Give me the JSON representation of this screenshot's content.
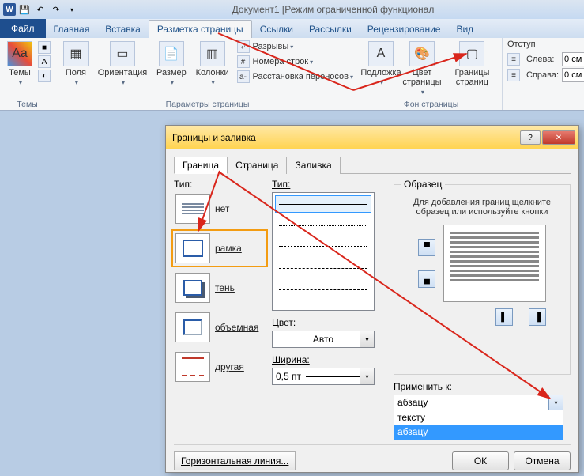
{
  "titlebar": {
    "doc_title": "Документ1 [Режим ограниченной функционал"
  },
  "tabs": {
    "file": "Файл",
    "items": [
      "Главная",
      "Вставка",
      "Разметка страницы",
      "Ссылки",
      "Рассылки",
      "Рецензирование",
      "Вид"
    ],
    "active_index": 2
  },
  "ribbon": {
    "themes": {
      "label": "Темы",
      "group": "Темы"
    },
    "page_params": {
      "fields": "Поля",
      "orientation": "Ориентация",
      "size": "Размер",
      "columns": "Колонки",
      "breaks": "Разрывы",
      "line_numbers": "Номера строк",
      "hyphenation": "Расстановка переносов",
      "group": "Параметры страницы"
    },
    "page_bg": {
      "watermark": "Подложка",
      "color": "Цвет страницы",
      "borders": "Границы страниц",
      "group": "Фон страницы"
    },
    "indent": {
      "header": "Отступ",
      "left": "Слева:",
      "right": "Справа:",
      "left_val": "0 см",
      "right_val": "0 см"
    }
  },
  "dialog": {
    "title": "Границы и заливка",
    "tabs": [
      "Граница",
      "Страница",
      "Заливка"
    ],
    "active_tab": 0,
    "type_label": "Тип:",
    "types": [
      {
        "name": "нет"
      },
      {
        "name": "рамка"
      },
      {
        "name": "тень"
      },
      {
        "name": "объемная"
      },
      {
        "name": "другая"
      }
    ],
    "selected_type": 1,
    "style_label": "Тип:",
    "color_label": "Цвет:",
    "color_value": "Авто",
    "width_label": "Ширина:",
    "width_value": "0,5 пт",
    "preview_label": "Образец",
    "preview_hint": "Для добавления границ щелкните образец или используйте кнопки",
    "apply_label": "Применить к:",
    "apply_selected": "абзацу",
    "apply_options": [
      "тексту",
      "абзацу"
    ],
    "hline": "Горизонтальная линия...",
    "ok": "ОК",
    "cancel": "Отмена"
  }
}
